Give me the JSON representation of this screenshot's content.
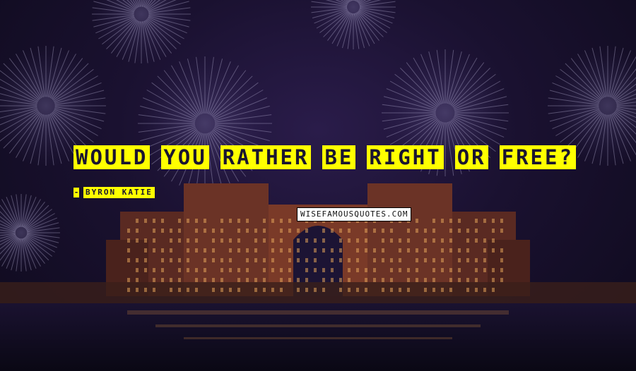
{
  "quote": {
    "words": [
      "WOULD",
      "YOU",
      "RATHER",
      "BE",
      "RIGHT",
      "OR",
      "FREE?"
    ]
  },
  "author": {
    "dash": "-",
    "name": "BYRON KATIE"
  },
  "watermark": {
    "text": "WISEFAMOUSQUOTES.COM"
  },
  "colors": {
    "highlight": "#ffff00",
    "text": "#1a1530",
    "sky": "#1a1130"
  }
}
